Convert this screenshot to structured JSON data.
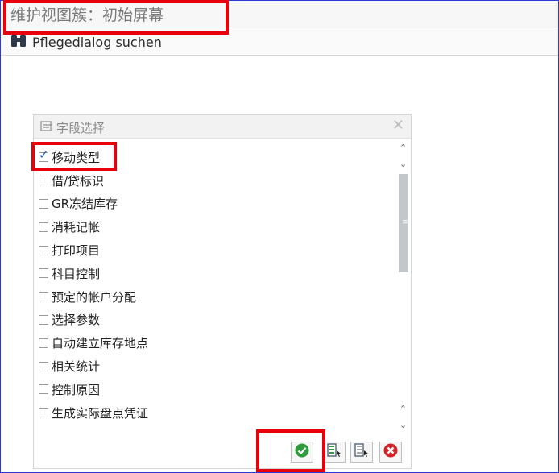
{
  "window": {
    "title": "维护视图簇：初始屏幕"
  },
  "toolbar": {
    "search_dialog_label": "Pflegedialog suchen"
  },
  "dialog": {
    "title": "字段选择",
    "items": [
      {
        "label": "移动类型",
        "checked": true
      },
      {
        "label": "借/贷标识",
        "checked": false
      },
      {
        "label": "GR冻结库存",
        "checked": false
      },
      {
        "label": "消耗记帐",
        "checked": false
      },
      {
        "label": "打印项目",
        "checked": false
      },
      {
        "label": "科目控制",
        "checked": false
      },
      {
        "label": "预定的帐户分配",
        "checked": false
      },
      {
        "label": "选择参数",
        "checked": false
      },
      {
        "label": "自动建立库存地点",
        "checked": false
      },
      {
        "label": "相关统计",
        "checked": false
      },
      {
        "label": "控制原因",
        "checked": false
      },
      {
        "label": "生成实际盘点凭证",
        "checked": false
      }
    ]
  },
  "colors": {
    "highlight": "#e8000b",
    "confirm": "#2f9b3d",
    "cancel": "#d8222a",
    "border": "#2a3bd6"
  },
  "icons": [
    "binoculars-icon",
    "field-select-icon",
    "close-icon",
    "confirm-icon",
    "select-all-icon",
    "deselect-all-icon",
    "cancel-icon"
  ]
}
